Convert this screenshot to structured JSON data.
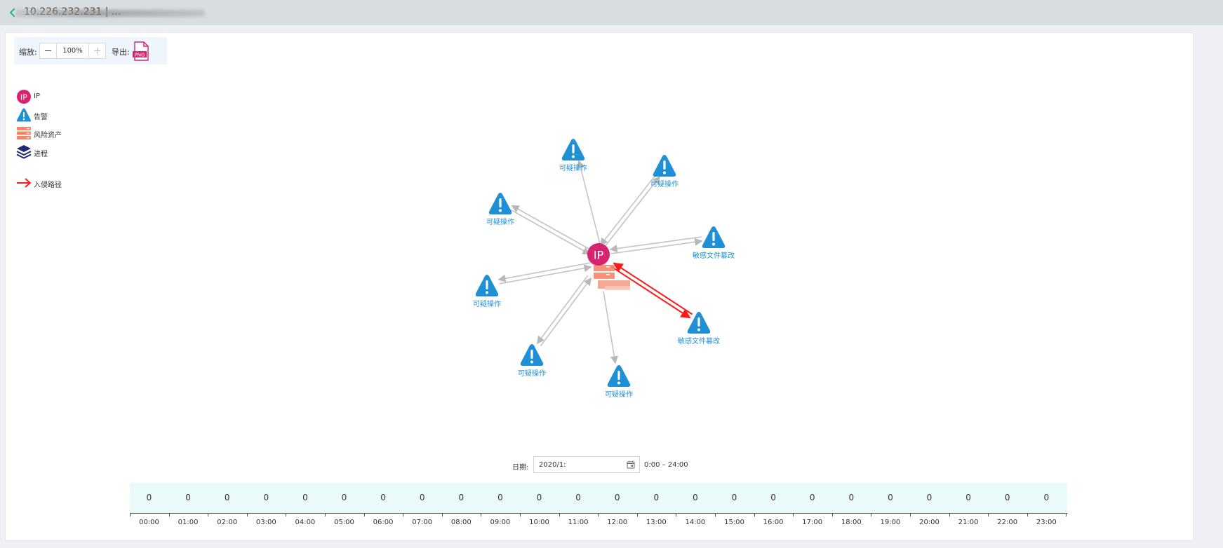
{
  "header": {
    "title": "10.226.232.231 | ...",
    "back_icon": "chevron-left-icon"
  },
  "toolbar": {
    "zoom_label": "缩放:",
    "zoom_value": "100%",
    "export_label": "导出:",
    "export_icon_text": "PNG"
  },
  "legend": [
    {
      "label": "IP",
      "icon": "ip-icon",
      "color": "#d6246e"
    },
    {
      "label": "告警",
      "icon": "alert-icon",
      "color": "#1f8fd6"
    },
    {
      "label": "风险资产",
      "icon": "server-icon",
      "color": "#f4866a"
    },
    {
      "label": "进程",
      "icon": "process-layers-icon",
      "color": "#1e2a78"
    },
    {
      "label": "入侵路径",
      "icon": "red-arrow-icon",
      "color": "#ff1a1a"
    }
  ],
  "graph": {
    "center_ip_text": "IP",
    "alerts": [
      "可疑操作",
      "可疑操作",
      "可疑操作",
      "敏感文件篡改",
      "可疑操作",
      "敏感文件篡改",
      "可疑操作",
      "可疑操作"
    ]
  },
  "date_filter": {
    "label": "日期:",
    "value": "2020/1:",
    "range": "0:00 – 24:00"
  },
  "timeline": {
    "counts": [
      0,
      0,
      0,
      0,
      0,
      0,
      0,
      0,
      0,
      0,
      0,
      0,
      0,
      0,
      0,
      0,
      0,
      0,
      0,
      0,
      0,
      0,
      0,
      0
    ],
    "hours": [
      "00:00",
      "01:00",
      "02:00",
      "03:00",
      "04:00",
      "05:00",
      "06:00",
      "07:00",
      "08:00",
      "09:00",
      "10:00",
      "11:00",
      "12:00",
      "13:00",
      "14:00",
      "15:00",
      "16:00",
      "17:00",
      "18:00",
      "19:00",
      "20:00",
      "21:00",
      "22:00",
      "23:00"
    ]
  }
}
